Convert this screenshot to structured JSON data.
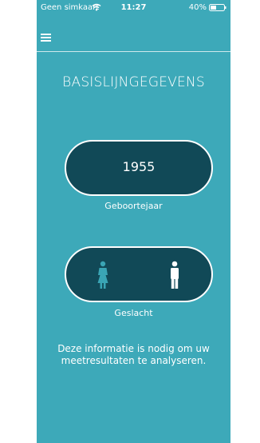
{
  "status_bar": {
    "carrier": "Geen simkaart",
    "time": "11:27",
    "battery": "40%"
  },
  "nav": {
    "menu_icon": "hamburger-menu-icon"
  },
  "page": {
    "title": "BASISLIJNGEGEVENS",
    "birth_year": {
      "value": "1955",
      "label": "Geboortejaar"
    },
    "gender": {
      "label": "Geslacht",
      "options": [
        {
          "icon": "female-icon",
          "selected": false
        },
        {
          "icon": "male-icon",
          "selected": true
        }
      ]
    },
    "info_text": "Deze informatie is nodig om uw meetresultaten te analyseren."
  },
  "colors": {
    "background": "#3da9b9",
    "pill": "#114957",
    "female_inactive": "#3aa5b5",
    "male_active": "#ffffff"
  }
}
